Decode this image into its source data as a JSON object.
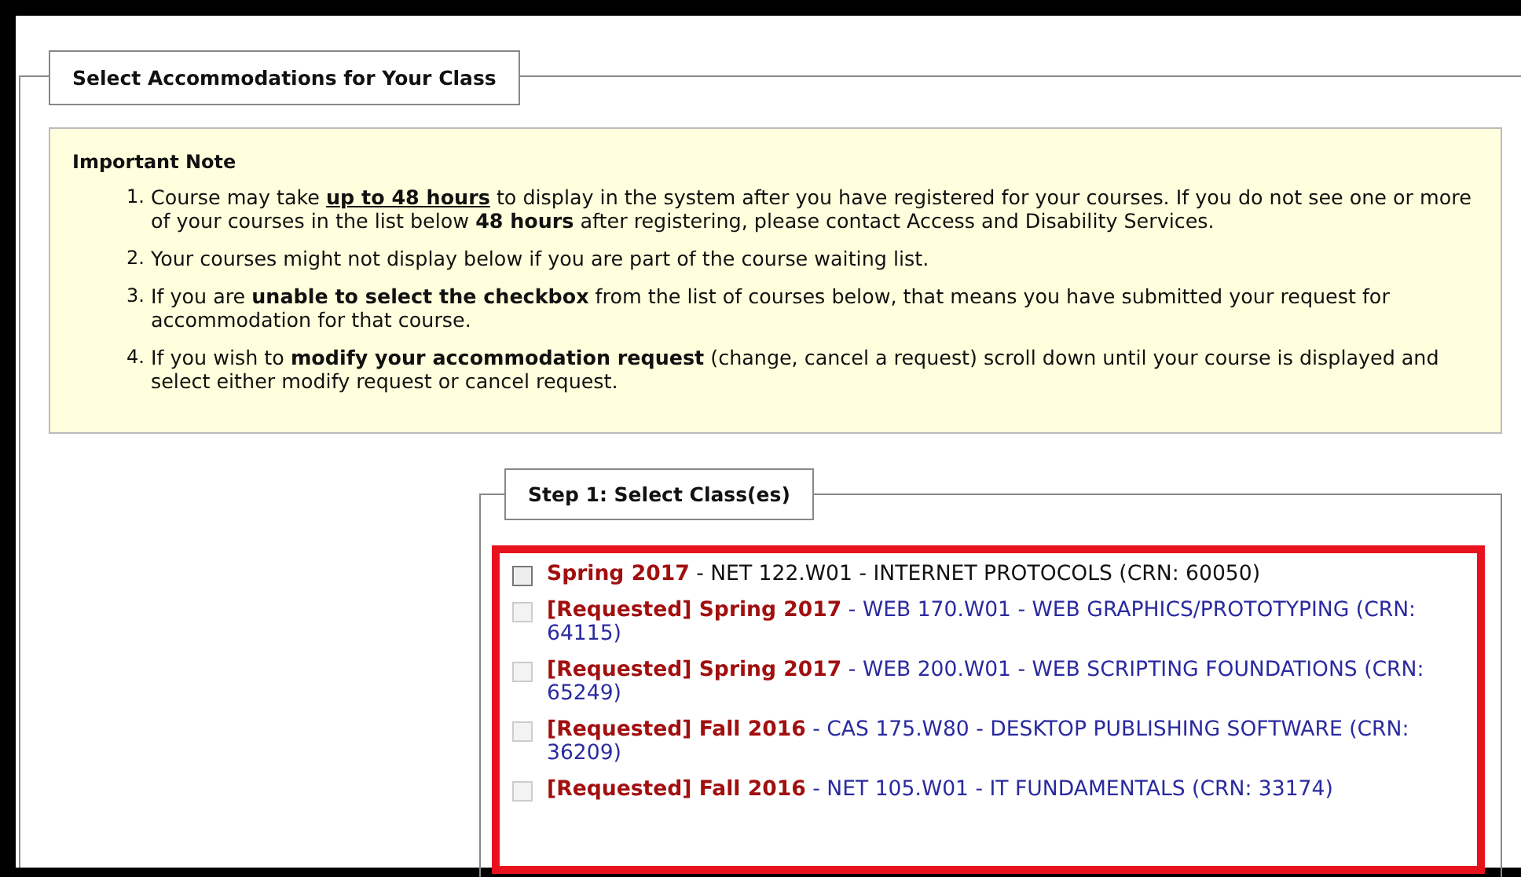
{
  "section": {
    "legend": "Select Accommodations for Your Class"
  },
  "note": {
    "title": "Important Note",
    "items": [
      {
        "number": "1.",
        "text": "Course may take **up to 48 hours** to display in the system after you have registered for your courses. If you do not see one or more of your courses in the list below **48 hours** after registering, please contact Access and Disability Services.",
        "underline_first_bold": true
      },
      {
        "number": "2.",
        "text": "Your courses might not display below if you are part of the course waiting list."
      },
      {
        "number": "3.",
        "text": "If you are **unable to select the checkbox** from the list of courses below, that means you have submitted your request for accommodation for that course.",
        "underline_first_bold": false
      },
      {
        "number": "4.",
        "text": "If you wish to **modify your accommodation request** (change, cancel a request) scroll down until your course is displayed and select either modify request or cancel request.",
        "underline_first_bold": false
      }
    ]
  },
  "step": {
    "legend": "Step 1: Select Class(es)",
    "courses": [
      {
        "label": "**Spring 2017** - NET 122.W01 - INTERNET PROTOCOLS (CRN: 60050)",
        "checked": false,
        "disabled": false
      },
      {
        "label": "**[Requested] Spring 2017** - WEB 170.W01 - WEB GRAPHICS/PROTOTYPING (CRN: 64115)",
        "checked": false,
        "disabled": true
      },
      {
        "label": "**[Requested] Spring 2017** - WEB 200.W01 - WEB SCRIPTING FOUNDATIONS (CRN: 65249)",
        "checked": false,
        "disabled": true
      },
      {
        "label": "**[Requested] Fall 2016** - CAS 175.W80 - DESKTOP PUBLISHING SOFTWARE (CRN: 36209)",
        "checked": false,
        "disabled": true
      },
      {
        "label": "**[Requested] Fall 2016** - NET 105.W01 - IT FUNDAMENTALS (CRN: 33174)",
        "checked": false,
        "disabled": true
      }
    ]
  }
}
